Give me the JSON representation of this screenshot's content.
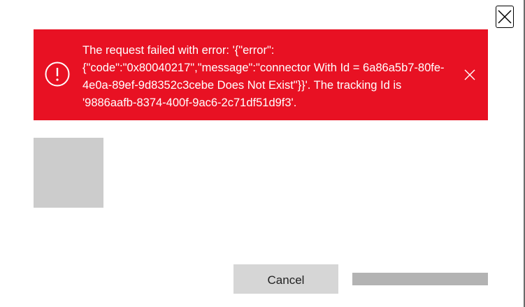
{
  "dialog": {
    "close_icon": "close-icon"
  },
  "error_banner": {
    "icon": "error-circle-icon",
    "dismiss_icon": "dismiss-icon",
    "background_color": "#e81123",
    "message": "The request failed with error: '{\"error\":{\"code\":\"0x80040217\",\"message\":\"connector With Id = 6a86a5b7-80fe-4e0a-89ef-9d8352c3cebe Does Not Exist\"}}'. The tracking Id is '9886aafb-8374-400f-9ac6-2c71df51d9f3'."
  },
  "actions": {
    "cancel_label": "Cancel"
  }
}
